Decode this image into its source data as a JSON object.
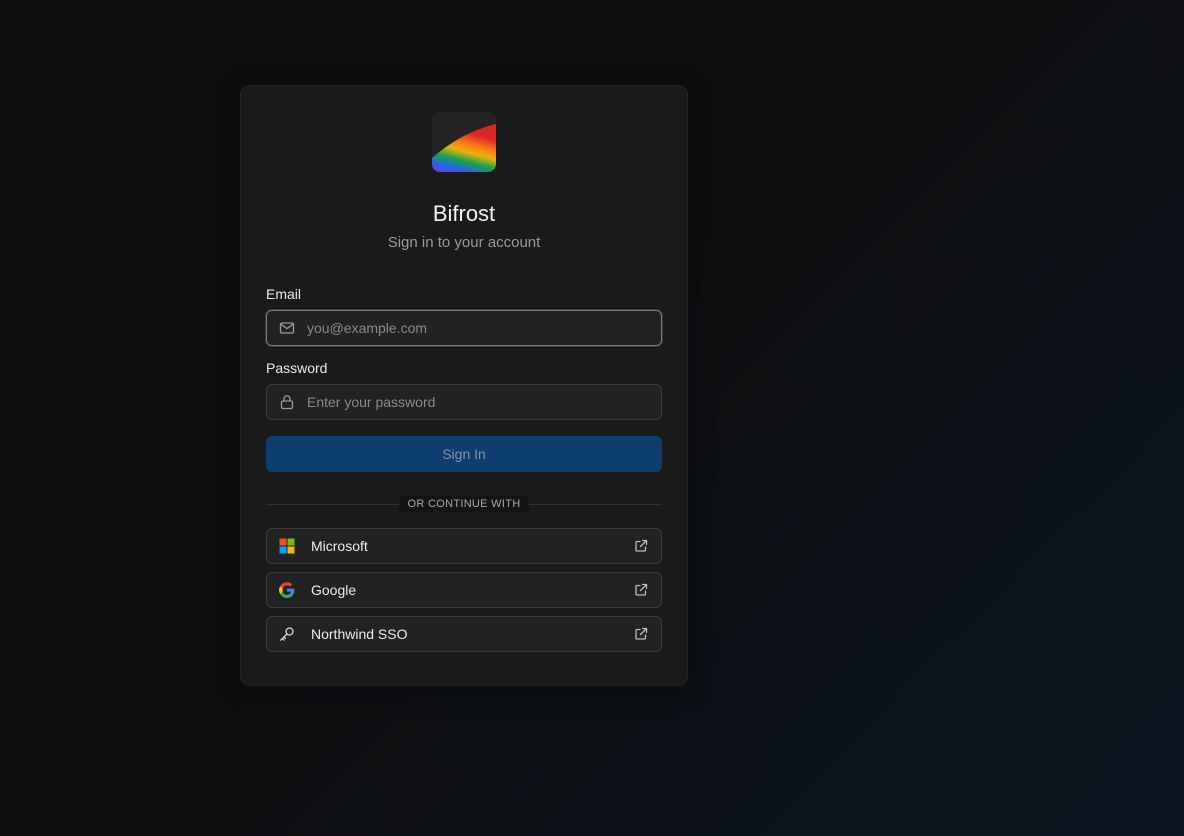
{
  "app": {
    "name": "Bifrost",
    "subtitle": "Sign in to your account",
    "logo_icon": "rainbow-bridge-logo"
  },
  "form": {
    "email": {
      "label": "Email",
      "placeholder": "you@example.com",
      "value": "",
      "icon": "mail-icon"
    },
    "password": {
      "label": "Password",
      "placeholder": "Enter your password",
      "value": "",
      "icon": "lock-icon"
    },
    "submit_label": "Sign In"
  },
  "divider_text": "OR CONTINUE WITH",
  "sso": {
    "providers": [
      {
        "label": "Microsoft",
        "icon": "microsoft-logo-icon"
      },
      {
        "label": "Google",
        "icon": "google-logo-icon"
      },
      {
        "label": "Northwind SSO",
        "icon": "key-icon"
      }
    ],
    "trailing_icon": "external-link-icon"
  },
  "colors": {
    "background": "#0e0e0e",
    "card": "#1a1a1a",
    "input_background": "#222222",
    "input_border": "#383838",
    "primary_button": "#0d3e6e",
    "primary_button_text": "#7f94a8",
    "text": "#ececec",
    "muted_text": "#9a9a9a"
  }
}
